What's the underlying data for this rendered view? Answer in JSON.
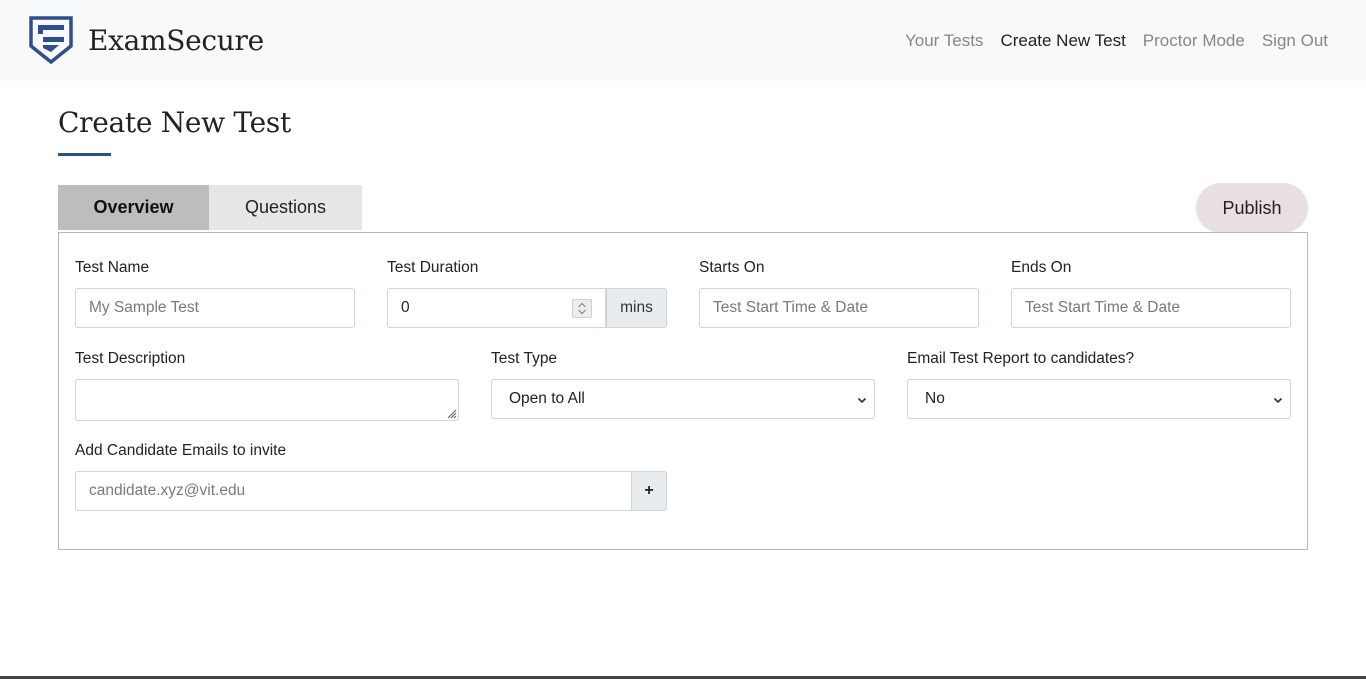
{
  "brand": {
    "name": "ExamSecure",
    "logo_icon": "shield-logo-icon",
    "accent_color": "#2f4d8f"
  },
  "nav": {
    "links": [
      {
        "label": "Your Tests",
        "active": false
      },
      {
        "label": "Create New Test",
        "active": true
      },
      {
        "label": "Proctor Mode",
        "active": false
      },
      {
        "label": "Sign Out",
        "active": false
      }
    ]
  },
  "page": {
    "title": "Create New Test"
  },
  "tabs": [
    {
      "label": "Overview",
      "active": true
    },
    {
      "label": "Questions",
      "active": false
    }
  ],
  "publish": {
    "label": "Publish"
  },
  "form": {
    "test_name": {
      "label": "Test Name",
      "placeholder": "My Sample Test",
      "value": ""
    },
    "test_duration": {
      "label": "Test Duration",
      "value": "0",
      "unit": "mins"
    },
    "starts_on": {
      "label": "Starts On",
      "placeholder": "Test Start Time & Date"
    },
    "ends_on": {
      "label": "Ends On",
      "placeholder": "Test Start Time & Date"
    },
    "test_description": {
      "label": "Test Description",
      "value": ""
    },
    "test_type": {
      "label": "Test Type",
      "selected": "Open to All"
    },
    "email_report": {
      "label": "Email Test Report to candidates?",
      "selected": "No"
    },
    "candidate_emails": {
      "label": "Add Candidate Emails to invite",
      "placeholder": "candidate.xyz@vit.edu",
      "add_label": "+"
    }
  }
}
